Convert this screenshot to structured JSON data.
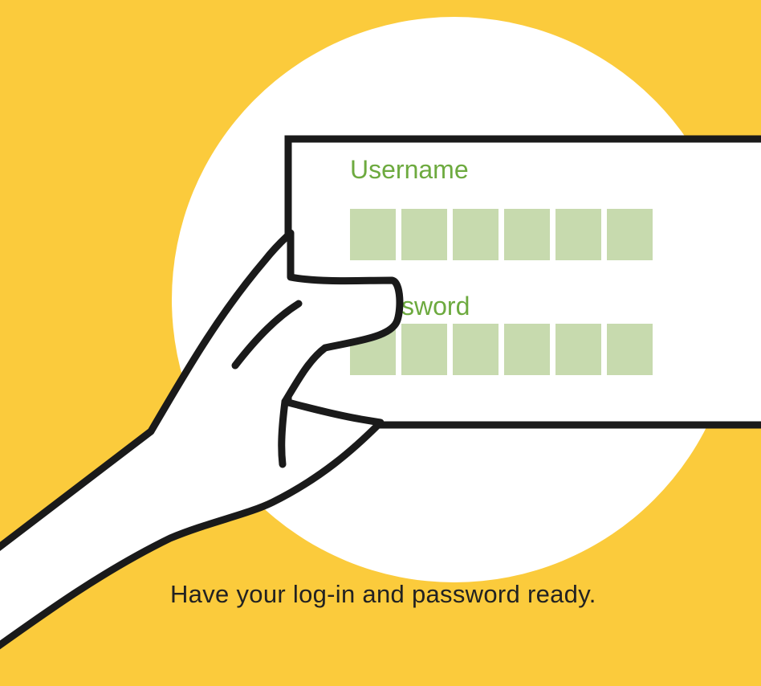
{
  "illustration": {
    "background_color": "#FBCB3C",
    "circle_color": "#FFFFFF",
    "card_fill": "#FFFFFF",
    "card_stroke": "#1A1A1A",
    "field_color": "#C7DAAE",
    "label_color": "#6DAA3F",
    "username_label": "Username",
    "password_label_visible": "sword",
    "username_cells": 6,
    "password_cells": 6,
    "icon": "hand-holding-card-icon"
  },
  "caption": {
    "text": "Have your log-in and password ready."
  }
}
